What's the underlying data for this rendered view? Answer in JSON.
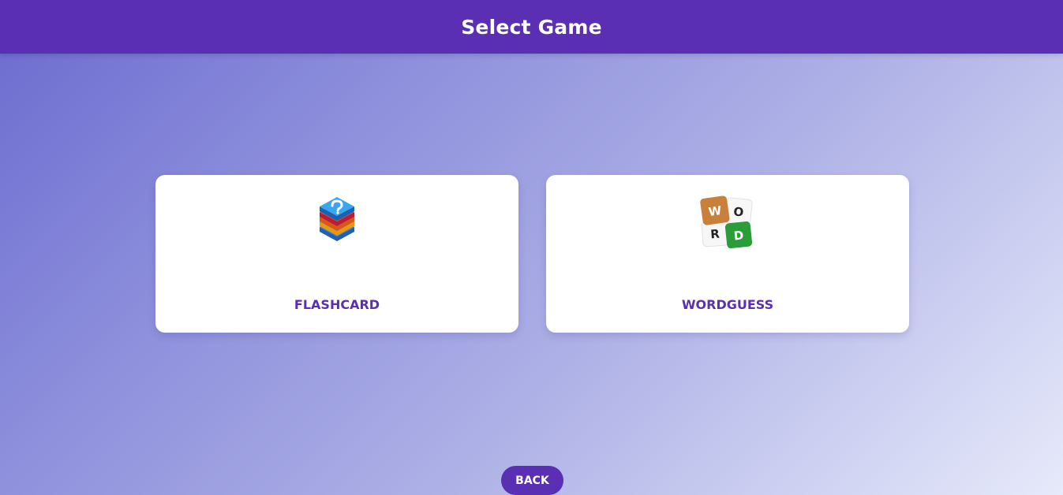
{
  "header": {
    "title": "Select Game"
  },
  "games": [
    {
      "label": "FLASHCARD",
      "icon": "stacked-cards-icon"
    },
    {
      "label": "WORDGUESS",
      "icon": "word-tiles-icon",
      "tiles": [
        "W",
        "O",
        "R",
        "D"
      ]
    }
  ],
  "footer": {
    "back_label": "BACK"
  },
  "colors": {
    "accent": "#5a2fb3",
    "card_background": "#ffffff",
    "tile_brown": "#c8803a",
    "tile_green": "#2a9d3a"
  }
}
